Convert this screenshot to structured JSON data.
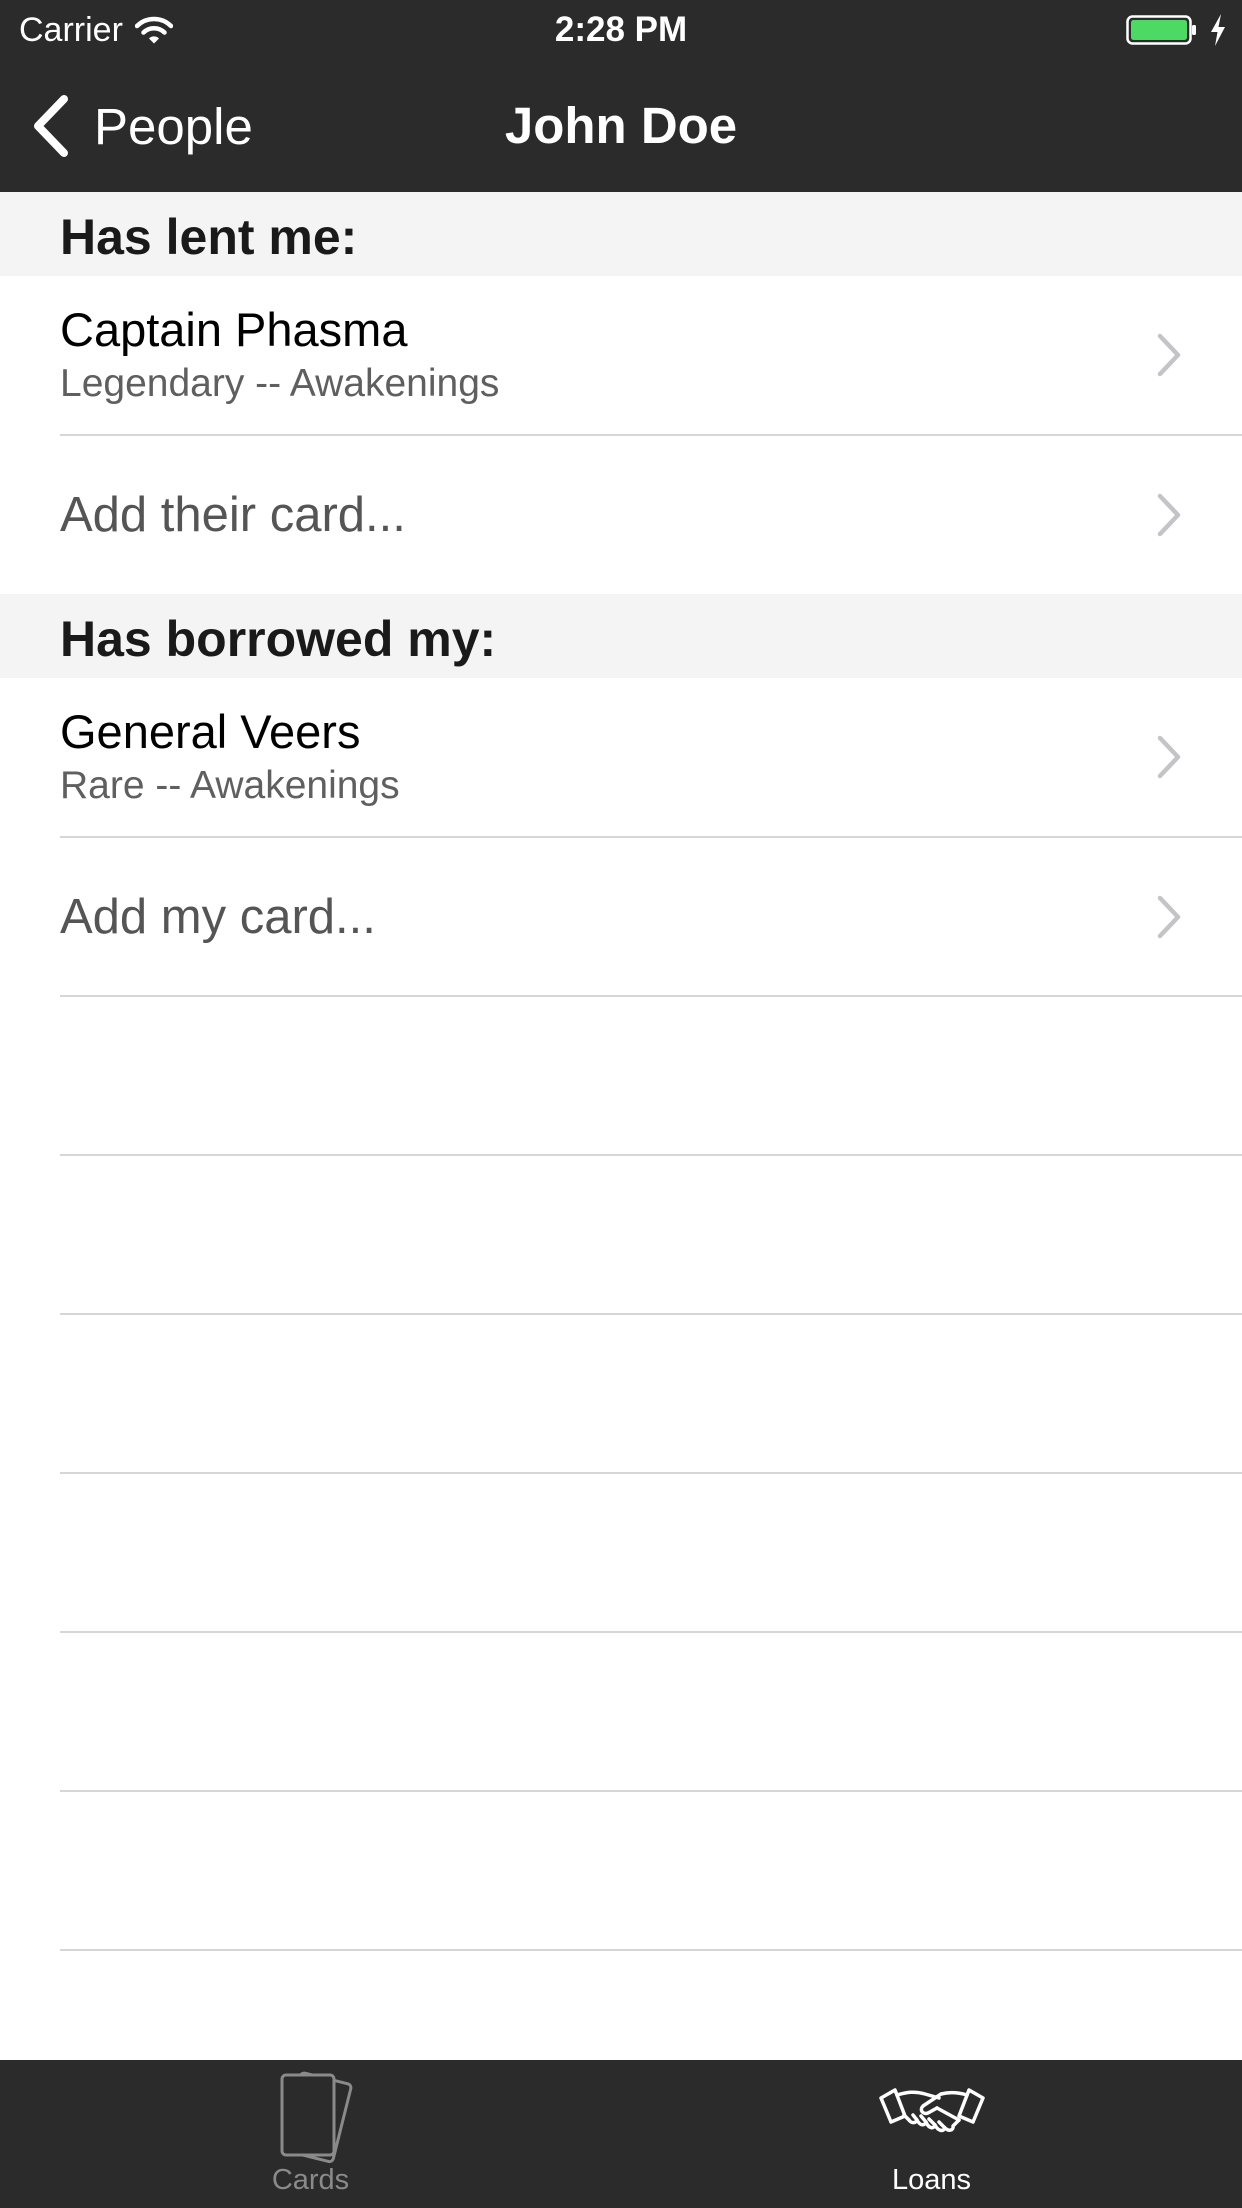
{
  "status_bar": {
    "carrier": "Carrier",
    "time": "2:28 PM",
    "battery_color": "#4cd964"
  },
  "nav": {
    "back_label": "People",
    "title": "John Doe"
  },
  "sections": [
    {
      "header": "Has lent me:",
      "items": [
        {
          "title": "Captain Phasma",
          "subtitle": "Legendary -- Awakenings"
        }
      ],
      "add_action": "Add their card..."
    },
    {
      "header": "Has borrowed my:",
      "items": [
        {
          "title": "General Veers",
          "subtitle": "Rare -- Awakenings"
        }
      ],
      "add_action": "Add my card..."
    }
  ],
  "tab_bar": {
    "tabs": [
      {
        "label": "Cards",
        "icon": "cards-icon",
        "selected": false
      },
      {
        "label": "Loans",
        "icon": "handshake-icon",
        "selected": true
      }
    ],
    "bar_color": "#2b2b2b",
    "selected_color": "#ffffff",
    "unselected_color": "#8a8a8a"
  }
}
